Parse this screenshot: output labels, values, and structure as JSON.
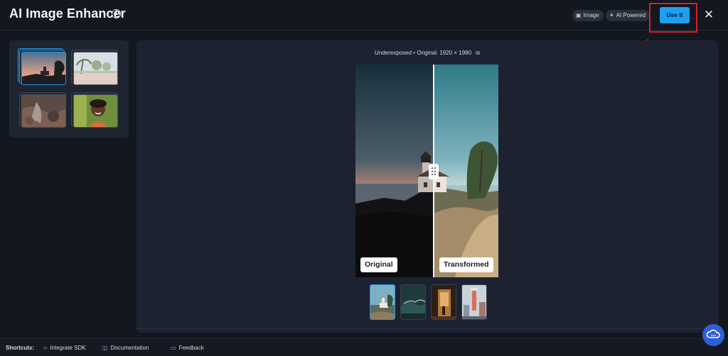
{
  "header": {
    "title": "AI Image Enhancer",
    "info_icon": "info-icon",
    "badges": [
      {
        "label": "Image",
        "icon": "image-icon"
      },
      {
        "label": "AI Powered",
        "icon": "sparkle-icon"
      }
    ],
    "use_it_label": "Use It",
    "close_icon": "close-icon"
  },
  "gallery": {
    "items": [
      {
        "name": "lighthouse-sunset",
        "selected": true
      },
      {
        "name": "beach-palm-trees",
        "selected": false
      },
      {
        "name": "rocky-landscape",
        "selected": false
      },
      {
        "name": "smiling-child",
        "selected": false
      }
    ]
  },
  "preview": {
    "meta": {
      "condition": "Underexposed",
      "separator": "•",
      "original_size": "Original: 1920 × 1980",
      "link_icon": "external-link-icon"
    },
    "original_label": "Original",
    "transformed_label": "Transformed",
    "split_position": 0.545,
    "samples": [
      {
        "name": "lighthouse",
        "active": true
      },
      {
        "name": "dark-landscape",
        "active": false
      },
      {
        "name": "doorway-sunset",
        "active": false
      },
      {
        "name": "city-tower",
        "active": false
      }
    ]
  },
  "footer": {
    "shortcuts_label": "Shortcuts:",
    "links": [
      {
        "label": "Integrate SDK",
        "icon": "code-icon"
      },
      {
        "label": "Documentation",
        "icon": "book-icon"
      },
      {
        "label": "Feedback",
        "icon": "chat-icon"
      }
    ]
  },
  "chat_fab_icon": "cloud-chat-icon",
  "colors": {
    "accent": "#1da0f2",
    "background": "#121720",
    "panel": "#1c2230",
    "annotation": "#d71f24"
  }
}
